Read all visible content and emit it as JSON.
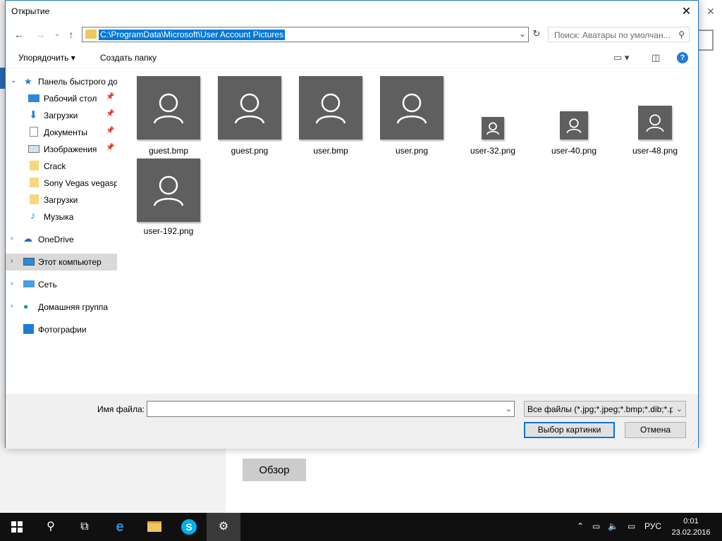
{
  "background": {
    "browse_button": "Обзор"
  },
  "dialog": {
    "title": "Открытие",
    "address": "C:\\ProgramData\\Microsoft\\User Account Pictures",
    "search_placeholder": "Поиск: Аватары по умолчан...",
    "toolbar": {
      "organize": "Упорядочить ▾",
      "new_folder": "Создать папку"
    },
    "nav": {
      "quick_access": "Панель быстрого дос",
      "desktop": "Рабочий стол",
      "downloads": "Загрузки",
      "documents": "Документы",
      "pictures": "Изображения",
      "crack": "Crack",
      "sony": "Sony Vegas vegaspr",
      "downloads2": "Загрузки",
      "music": "Музыка",
      "onedrive": "OneDrive",
      "this_pc": "Этот компьютер",
      "network": "Сеть",
      "homegroup": "Домашняя группа",
      "photos": "Фотографии"
    },
    "files": [
      "guest.bmp",
      "guest.png",
      "user.bmp",
      "user.png",
      "user-32.png",
      "user-40.png",
      "user-48.png",
      "user-192.png"
    ],
    "filename_label": "Имя файла:",
    "filename_value": "",
    "filter": "Все файлы (*.jpg;*.jpeg;*.bmp;*.dib;*.p",
    "ok_button": "Выбор картинки",
    "cancel_button": "Отмена"
  },
  "taskbar": {
    "lang": "РУС",
    "time": "0:01",
    "date": "23.02.2016"
  },
  "colors": {
    "accent": "#0078d7",
    "thumb": "#5f5f5f",
    "taskbar": "#101010"
  }
}
